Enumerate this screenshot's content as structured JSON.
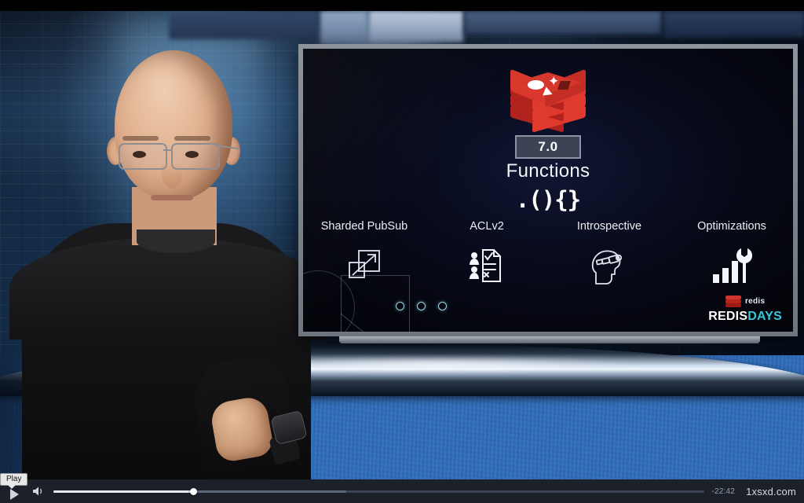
{
  "slide": {
    "version_badge": "7.0",
    "title": "Functions",
    "code_glyph": ".(){}",
    "logo_name": "redis-logo",
    "features": [
      {
        "label": "Sharded PubSub",
        "icon": "scale-arrow-icon"
      },
      {
        "label": "ACLv2",
        "icon": "access-control-document-icon"
      },
      {
        "label": "Introspective",
        "icon": "head-telescope-icon"
      },
      {
        "label": "Optimizations",
        "icon": "bar-chart-wrench-icon"
      }
    ],
    "carousel": {
      "dots": 3,
      "active_index": -1
    },
    "brand": {
      "mark_label": "redis",
      "days_white": "REDIS",
      "days_cyan": "DAYS"
    },
    "colors": {
      "redis_red": "#d5372c",
      "brand_cyan": "#38c6d9",
      "slide_bg": "#0a0d22",
      "badge_bg": "#3c4355"
    }
  },
  "player": {
    "play_tooltip": "Play",
    "play_label": "Play",
    "volume_label": "Mute",
    "time_remaining": "-22:42",
    "watermark": "1xsxd.com",
    "progress_percent": 21.5,
    "buffered_percent": 45
  }
}
